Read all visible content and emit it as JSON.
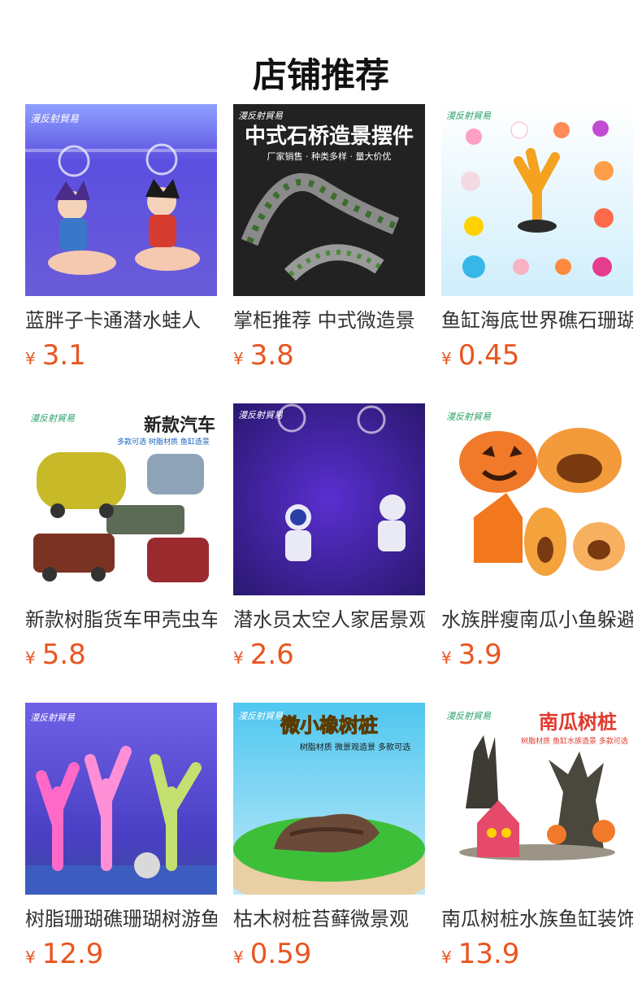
{
  "page_title": "店铺推荐",
  "currency_symbol": "¥",
  "colors": {
    "price": "#e8551f",
    "title": "#333333",
    "heading": "#111111"
  },
  "products": [
    {
      "title": "蓝胖子卡通潜水蛙人",
      "price": "3.1",
      "image": {
        "brand": "漫反射貿易",
        "caption": "",
        "subcaption": ""
      }
    },
    {
      "title": "掌柜推荐 中式微造景",
      "price": "3.8",
      "image": {
        "brand": "漫反射貿易",
        "caption": "中式石桥造景摆件",
        "subcaption": "厂家销售 · 种类多样 · 量大价优"
      }
    },
    {
      "title": "鱼缸海底世界礁石珊瑚",
      "price": "0.45",
      "image": {
        "brand": "漫反射貿易",
        "caption": "",
        "subcaption": ""
      }
    },
    {
      "title": "新款树脂货车甲壳虫车",
      "price": "5.8",
      "image": {
        "brand": "漫反射貿易",
        "caption": "新款汽车",
        "subcaption": "多款可选 树脂材质 鱼缸造景"
      }
    },
    {
      "title": "潜水员太空人家居景观",
      "price": "2.6",
      "image": {
        "brand": "漫反射貿易",
        "caption": "",
        "subcaption": ""
      }
    },
    {
      "title": "水族胖瘦南瓜小鱼躲避屋",
      "price": "3.9",
      "image": {
        "brand": "漫反射貿易",
        "caption": "",
        "subcaption": ""
      }
    },
    {
      "title": "树脂珊瑚礁珊瑚树游鱼",
      "price": "12.9",
      "image": {
        "brand": "漫反射貿易",
        "caption": "",
        "subcaption": ""
      }
    },
    {
      "title": "枯木树桩苔藓微景观",
      "price": "0.59",
      "image": {
        "brand": "漫反射貿易",
        "caption": "微小橡树桩",
        "subcaption": "树脂材质 微景观造景 多款可选"
      }
    },
    {
      "title": "南瓜树桩水族鱼缸装饰",
      "price": "13.9",
      "image": {
        "brand": "漫反射貿易",
        "caption": "南瓜树桩",
        "subcaption": "树脂材质 鱼缸水族造景 多款可选"
      }
    }
  ]
}
